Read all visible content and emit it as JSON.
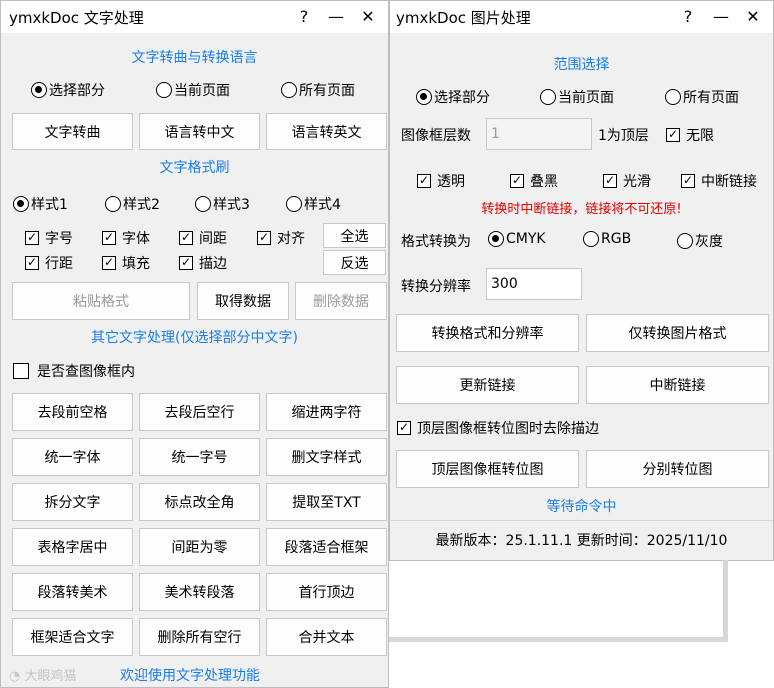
{
  "left": {
    "title": "ymxkDoc  文字处理",
    "controls": {
      "help": "?",
      "minimize": "—",
      "close": "✕"
    },
    "section_convert": "文字转曲与转换语言",
    "range_options": [
      "选择部分",
      "当前页面",
      "所有页面"
    ],
    "convert_buttons": [
      "文字转曲",
      "语言转中文",
      "语言转英文"
    ],
    "section_format": "文字格式刷",
    "styles": [
      "样式1",
      "样式2",
      "样式3",
      "样式4"
    ],
    "attr_row1": [
      "字号",
      "字体",
      "间距",
      "对齐"
    ],
    "attr_row2": [
      "行距",
      "填充",
      "描边"
    ],
    "select_all": "全选",
    "invert": "反选",
    "paste_format": "粘贴格式",
    "get_data": "取得数据",
    "delete_data": "删除数据",
    "section_other": "其它文字处理(仅选择部分中文字)",
    "check_frames": "是否查图像框内",
    "tools": [
      [
        "去段前空格",
        "去段后空行",
        "缩进两字符"
      ],
      [
        "统一字体",
        "统一字号",
        "删文字样式"
      ],
      [
        "拆分文字",
        "标点改全角",
        "提取至TXT"
      ],
      [
        "表格字居中",
        "间距为零",
        "段落适合框架"
      ],
      [
        "段落转美术",
        "美术转段落",
        "首行顶边"
      ],
      [
        "框架适合文字",
        "删除所有空行",
        "合并文本"
      ]
    ],
    "welcome": "欢迎使用文字处理功能",
    "watermark": "大眼鸡猫"
  },
  "right": {
    "title": "ymxkDoc  图片处理",
    "controls": {
      "help": "?",
      "minimize": "—",
      "close": "✕"
    },
    "section_range": "范围选择",
    "range_options": [
      "选择部分",
      "当前页面",
      "所有页面"
    ],
    "layer_label": "图像框层数",
    "layer_value": "1",
    "layer_top": "1为顶层",
    "unlimited": "无限",
    "options": [
      "透明",
      "叠黑",
      "光滑",
      "中断链接"
    ],
    "warning": "转换时中断链接，链接将不可还原!",
    "format_label": "格式转换为",
    "formats": [
      "CMYK",
      "RGB",
      "灰度"
    ],
    "resolution_label": "转换分辨率",
    "resolution_value": "300",
    "btn_convert_both": "转换格式和分辨率",
    "btn_convert_format": "仅转换图片格式",
    "btn_update_link": "更新链接",
    "btn_break_link": "中断链接",
    "remove_stroke": "顶层图像框转位图时去除描边",
    "btn_top_bitmap": "顶层图像框转位图",
    "btn_each_bitmap": "分别转位图",
    "status": "等待命令中",
    "footer": "最新版本：25.1.11.1 更新时间：2025/11/10"
  },
  "colors": {
    "accent": "#1a7ee8",
    "warning": "#e00000",
    "window_bg": "#f0f0f0"
  }
}
